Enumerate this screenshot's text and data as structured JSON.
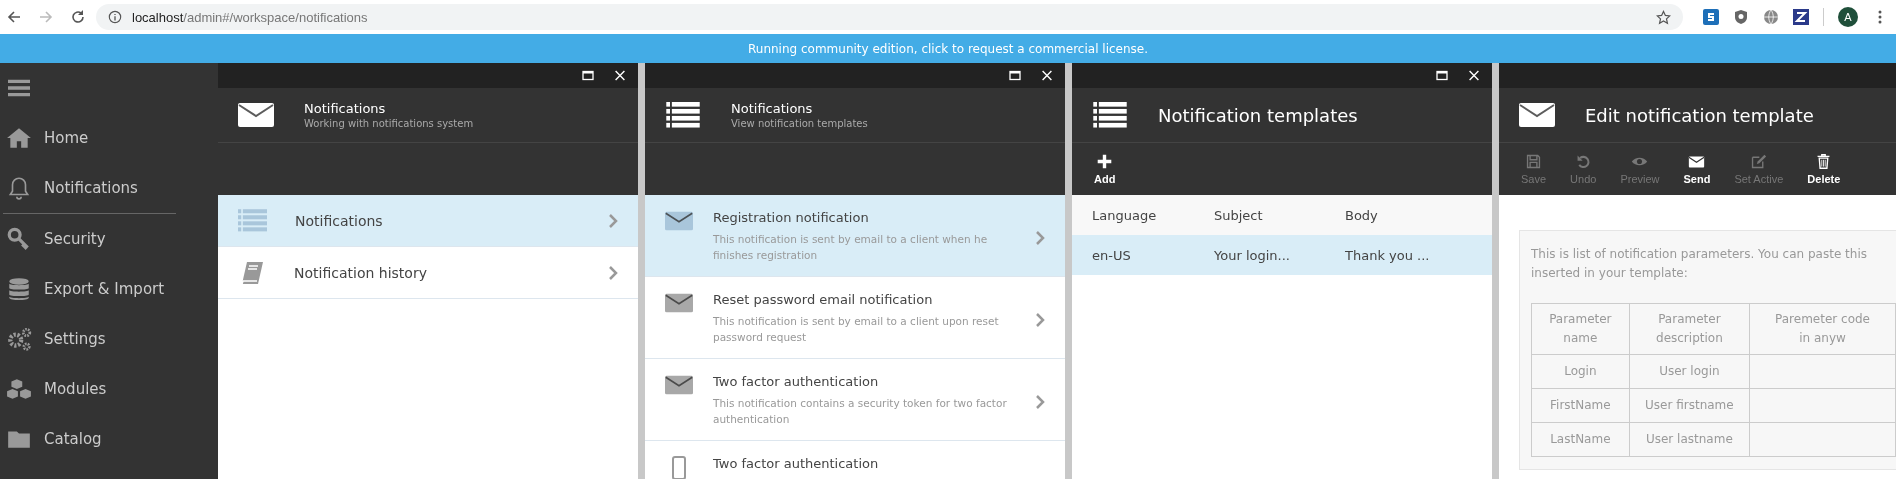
{
  "browser": {
    "url_host": "localhost",
    "url_path": "/admin#/workspace/notifications",
    "profile_initial": "A"
  },
  "banner": {
    "text": "Running community edition, click to request a commercial license."
  },
  "sidebar": {
    "items": [
      {
        "label": "Home",
        "divider_after": false
      },
      {
        "label": "Notifications",
        "divider_after": true
      },
      {
        "label": "Security",
        "divider_after": false
      },
      {
        "label": "Export & Import",
        "divider_after": false
      },
      {
        "label": "Settings",
        "divider_after": false
      },
      {
        "label": "Modules",
        "divider_after": false
      },
      {
        "label": "Catalog",
        "divider_after": false
      }
    ]
  },
  "blades": [
    {
      "kind": "menu",
      "title": "Notifications",
      "subtitle": "Working with notifications system",
      "window_controls": true,
      "items": [
        {
          "label": "Notifications",
          "selected": true
        },
        {
          "label": "Notification history",
          "selected": false
        }
      ]
    },
    {
      "kind": "list",
      "title": "Notifications",
      "subtitle": "View notification templates",
      "window_controls": true,
      "items": [
        {
          "title": "Registration notification",
          "description": "This notification is sent by email to a client when he finishes registration",
          "selected": true
        },
        {
          "title": "Reset password email notification",
          "description": "This notification is sent by email to a client upon reset password request",
          "selected": false
        },
        {
          "title": "Two factor authentication",
          "description": "This notification contains a security token for two factor authentication",
          "selected": false
        },
        {
          "title": "Two factor authentication",
          "selected": false
        }
      ]
    },
    {
      "kind": "table",
      "title": "Notification templates",
      "window_controls": true,
      "toolbar": [
        {
          "label": "Add",
          "disabled": false
        }
      ],
      "table": {
        "columns": [
          "Language",
          "Subject",
          "Body"
        ],
        "rows": [
          {
            "cells": [
              "en-US",
              "Your login...",
              "Thank you ..."
            ],
            "selected": true
          }
        ]
      }
    },
    {
      "kind": "editor",
      "title": "Edit notification template",
      "window_controls": false,
      "toolbar": [
        {
          "label": "Save",
          "disabled": true
        },
        {
          "label": "Undo",
          "disabled": true
        },
        {
          "label": "Preview",
          "disabled": true
        },
        {
          "label": "Send",
          "disabled": false
        },
        {
          "label": "Set Active",
          "disabled": true
        },
        {
          "label": "Delete",
          "disabled": false
        }
      ],
      "note_lines": [
        "This is list of notification parameters. You can paste this",
        "inserted in your template:"
      ],
      "params": {
        "columns": [
          "Parameter name",
          "Parameter description",
          "Paremeter code in anyw"
        ],
        "rows": [
          [
            "Login",
            "User login"
          ],
          [
            "FirstName",
            "User firstname"
          ],
          [
            "LastName",
            "User lastname"
          ]
        ]
      }
    }
  ]
}
